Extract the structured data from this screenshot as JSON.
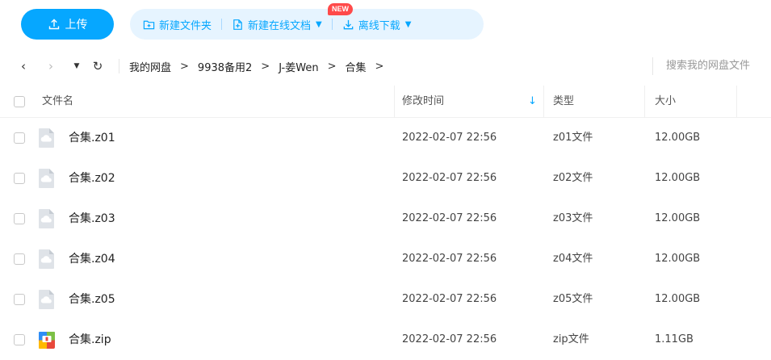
{
  "toolbar": {
    "upload_label": "上传",
    "new_folder_label": "新建文件夹",
    "new_online_doc_label": "新建在线文档",
    "new_badge": "NEW",
    "offline_download_label": "离线下载",
    "caret": "▼",
    "accent_color": "#06a7ff"
  },
  "nav": {
    "back_icon": "‹",
    "forward_icon": "›",
    "dropdown_icon": "▼",
    "refresh_icon": "↻",
    "crumb_separator": ">",
    "breadcrumb": [
      "我的网盘",
      "9938备用2",
      "J-姜Wen",
      "合集"
    ],
    "search_placeholder": "搜索我的网盘文件"
  },
  "table": {
    "columns": {
      "name": "文件名",
      "modified": "修改时间",
      "type": "类型",
      "size": "大小"
    },
    "sort_icon": "↓",
    "rows": [
      {
        "name": "合集.z01",
        "modified": "2022-02-07 22:56",
        "type": "z01文件",
        "size": "12.00GB",
        "icon": "file-generic-icon"
      },
      {
        "name": "合集.z02",
        "modified": "2022-02-07 22:56",
        "type": "z02文件",
        "size": "12.00GB",
        "icon": "file-generic-icon"
      },
      {
        "name": "合集.z03",
        "modified": "2022-02-07 22:56",
        "type": "z03文件",
        "size": "12.00GB",
        "icon": "file-generic-icon"
      },
      {
        "name": "合集.z04",
        "modified": "2022-02-07 22:56",
        "type": "z04文件",
        "size": "12.00GB",
        "icon": "file-generic-icon"
      },
      {
        "name": "合集.z05",
        "modified": "2022-02-07 22:56",
        "type": "z05文件",
        "size": "12.00GB",
        "icon": "file-generic-icon"
      },
      {
        "name": "合集.zip",
        "modified": "2022-02-07 22:56",
        "type": "zip文件",
        "size": "1.11GB",
        "icon": "zip-archive-icon"
      }
    ]
  }
}
